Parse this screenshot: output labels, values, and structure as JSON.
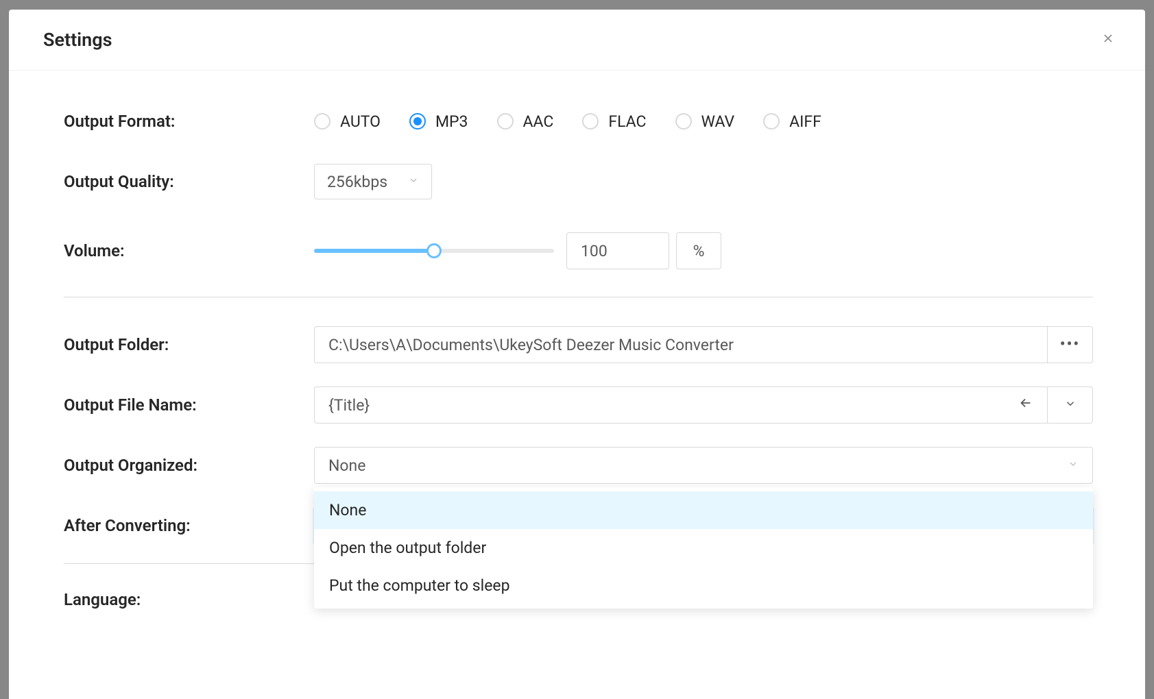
{
  "title": "Settings",
  "labels": {
    "output_format": "Output Format:",
    "output_quality": "Output Quality:",
    "volume": "Volume:",
    "output_folder": "Output Folder:",
    "output_file_name": "Output File Name:",
    "output_organized": "Output Organized:",
    "after_converting": "After Converting:",
    "language": "Language:"
  },
  "output_format": {
    "options": [
      "AUTO",
      "MP3",
      "AAC",
      "FLAC",
      "WAV",
      "AIFF"
    ],
    "selected": "MP3"
  },
  "output_quality": {
    "value": "256kbps"
  },
  "volume": {
    "value": "100",
    "unit": "%",
    "percent": 50
  },
  "output_folder": {
    "value": "C:\\Users\\A\\Documents\\UkeySoft Deezer Music Converter"
  },
  "output_file_name": {
    "value": "{Title}"
  },
  "output_organized": {
    "value": "None"
  },
  "after_converting": {
    "value": "None",
    "options": [
      "None",
      "Open the output folder",
      "Put the computer to sleep"
    ],
    "open": true
  }
}
